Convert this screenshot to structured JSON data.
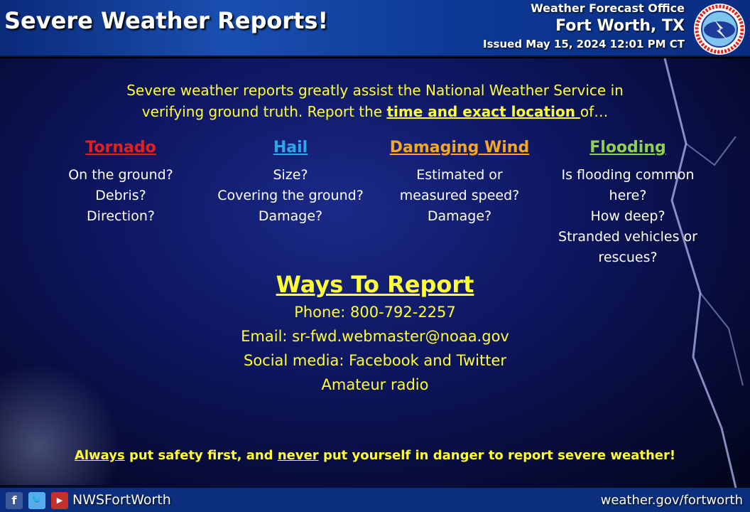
{
  "header": {
    "title": "Severe Weather Reports!",
    "office_line": "Weather Forecast Office",
    "city": "Fort Worth, TX",
    "issued": "Issued May 15, 2024 12:01 PM CT",
    "logo_text": "NATIONAL WEATHER SERVICE"
  },
  "intro": {
    "line1": "Severe weather reports greatly assist the National Weather Service in",
    "line2_pre": "verifying ground truth. Report the ",
    "line2_emph": "time and exact location ",
    "line2_post": "of…"
  },
  "categories": [
    {
      "title": "Tornado",
      "color": "#e8201c",
      "lines": [
        "On the ground?",
        "Debris?",
        "Direction?"
      ]
    },
    {
      "title": "Hail",
      "color": "#2ea6ec",
      "lines": [
        "Size?",
        "Covering the ground?",
        "Damage?"
      ]
    },
    {
      "title": "Damaging Wind",
      "color": "#f5a623",
      "lines": [
        "Estimated or",
        "measured speed?",
        "Damage?"
      ]
    },
    {
      "title": "Flooding",
      "color": "#8fd14f",
      "lines": [
        "Is flooding common",
        "here?",
        "How deep?",
        "Stranded vehicles or",
        "rescues?"
      ]
    }
  ],
  "ways": {
    "title": "Ways To Report",
    "items": [
      "Phone: 800-792-2257",
      "Email: sr-fwd.webmaster@noaa.gov",
      "Social media: Facebook and Twitter",
      "Amateur radio"
    ]
  },
  "safety": {
    "w1": "Always",
    "t1": " put safety first, and ",
    "w2": "never",
    "t2": " put yourself in danger to report severe weather!"
  },
  "footer": {
    "handle": "NWSFortWorth",
    "website": "weather.gov/fortworth",
    "icons": [
      "facebook-icon",
      "twitter-icon",
      "youtube-icon"
    ]
  }
}
